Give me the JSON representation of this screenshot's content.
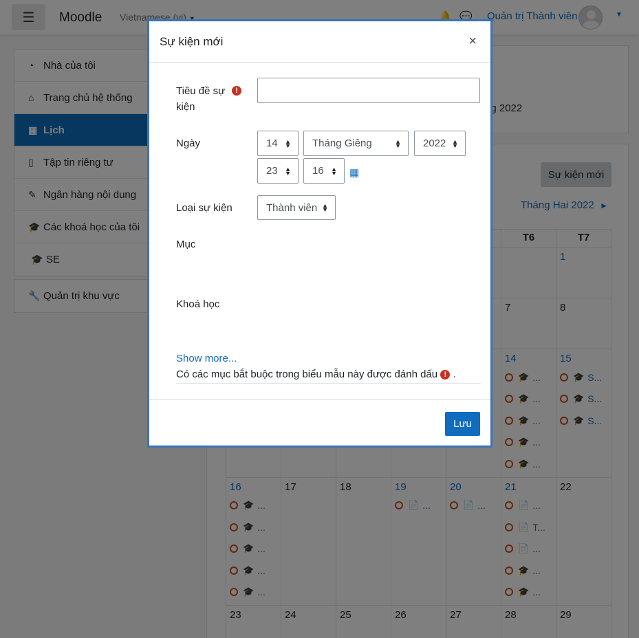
{
  "navbar": {
    "brand": "Moodle",
    "language": "Vietnamese (vi)",
    "username": "Quản trị Thành viên"
  },
  "sidebar": {
    "group1": [
      {
        "icon": "dashboard-icon",
        "label": "Nhà của tôi"
      },
      {
        "icon": "home-icon",
        "label": "Trang chủ hệ thống"
      },
      {
        "icon": "calendar-icon",
        "label": "Lịch"
      },
      {
        "icon": "file-icon",
        "label": "Tập tin riêng tư"
      },
      {
        "icon": "paintbrush-icon",
        "label": "Ngân hàng nội dung"
      },
      {
        "icon": "graduation-cap-icon",
        "label": "Các khoá học của tôi"
      },
      {
        "icon": "graduation-cap-icon",
        "label": "SE"
      }
    ],
    "group2": [
      {
        "icon": "wrench-icon",
        "label": "Quản trị khu vực"
      }
    ]
  },
  "main": {
    "partial_heading": "ng 2022",
    "new_event_button": "Sự kiện mới",
    "next_month": "Tháng Hai 2022",
    "weekday_headers": [
      "T6",
      "T7"
    ],
    "rows": [
      [
        "",
        "",
        "",
        "",
        "",
        "1"
      ],
      [
        "",
        "",
        "",
        "",
        "7",
        "8"
      ],
      [
        "",
        "",
        "",
        "",
        "14",
        "15"
      ],
      [
        "16",
        "17",
        "18",
        "19",
        "20",
        "21",
        "22"
      ],
      [
        "23",
        "24",
        "25",
        "26",
        "27",
        "28",
        "29"
      ]
    ],
    "event_text": {
      "ellipsis": "...",
      "s_ellipsis": "S...",
      "t_ellipsis": "T..."
    }
  },
  "modal": {
    "title": "Sự kiện mới",
    "close": "×",
    "fields": {
      "title_label": "Tiêu đề sự kiện",
      "title_value": "",
      "date_label": "Ngày",
      "day": "14",
      "month": "Tháng Giêng",
      "year": "2022",
      "hour": "23",
      "minute": "16",
      "type_label": "Loại sự kiện",
      "type_value": "Thành viên",
      "category_label": "Mục",
      "course_label": "Khoá học"
    },
    "show_more": "Show more...",
    "required_note": "Có các mục bắt buộc trong biểu mẫu này được đánh dấu",
    "required_note_end": ".",
    "save": "Lưu"
  },
  "colors": {
    "accent": "#0f6cbf",
    "event_circle": "#c8511b",
    "required": "#ca3120"
  }
}
